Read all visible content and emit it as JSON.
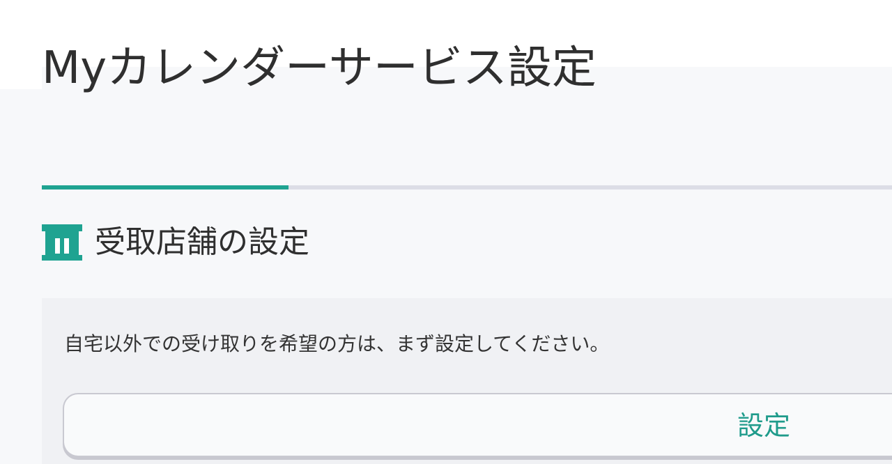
{
  "header": {
    "title": "Myカレンダーサービス設定"
  },
  "progress": {
    "fraction": 0.29,
    "accent_color": "#1fa391",
    "track_color": "#dcdde6"
  },
  "section": {
    "icon": "store-icon",
    "title": "受取店舗の設定",
    "description": "自宅以外での受け取りを希望の方は、まず設定してください。",
    "button_label": "設定"
  }
}
